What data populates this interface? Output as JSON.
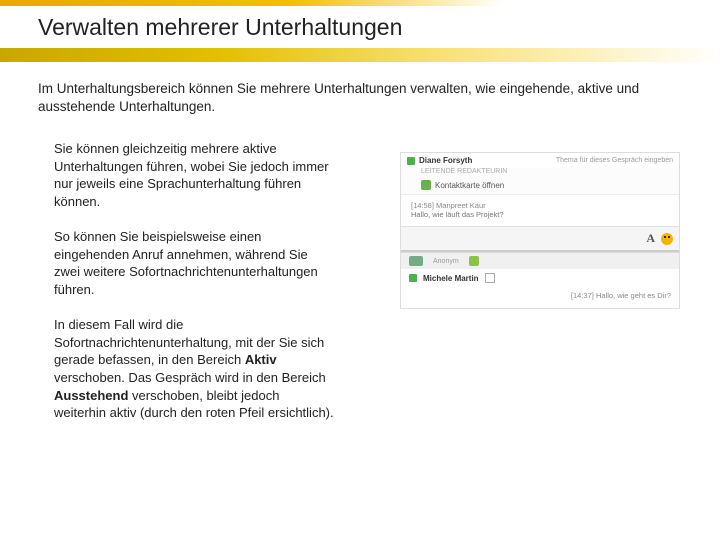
{
  "title": "Verwalten mehrerer Unterhaltungen",
  "intro": "Im Unterhaltungsbereich können Sie mehrere Unterhaltungen verwalten, wie eingehende, aktive und ausstehende Unterhaltungen.",
  "p1": "Sie können gleichzeitig mehrere aktive Unterhaltungen führen, wobei Sie jedoch immer nur jeweils eine Sprachunterhaltung führen können.",
  "p2": "So können Sie beispielsweise einen eingehenden Anruf annehmen, während Sie zwei weitere Sofortnachrichtenunterhaltungen führen.",
  "p3a": "In diesem Fall wird die Sofortnachrichtenunterhaltung, mit der Sie sich gerade befassen, in den Bereich ",
  "p3b": "Aktiv",
  "p3c": " verschoben. Das Gespräch wird in den Bereich ",
  "p3d": "Ausstehend",
  "p3e": " verschoben, bleibt jedoch weiterhin aktiv (durch den roten Pfeil ersichtlich).",
  "shot": {
    "c1": {
      "name": "Diane Forsyth",
      "role": "LEITENDE REDAKTEURIN",
      "topic": "Thema für dieses Gespräch eingeben",
      "status": "Kontaktkarte öffnen",
      "msg_time": "[14:58]",
      "msg_from": "Manpreet Kaur",
      "msg_text": "Hallo, wie läuft das Projekt?"
    },
    "bar": {
      "anon": "Anonym"
    },
    "c2": {
      "name": "Michele Martin",
      "msg_time": "[14:37]",
      "msg_text": "Hallo, wie geht es Dir?"
    }
  }
}
